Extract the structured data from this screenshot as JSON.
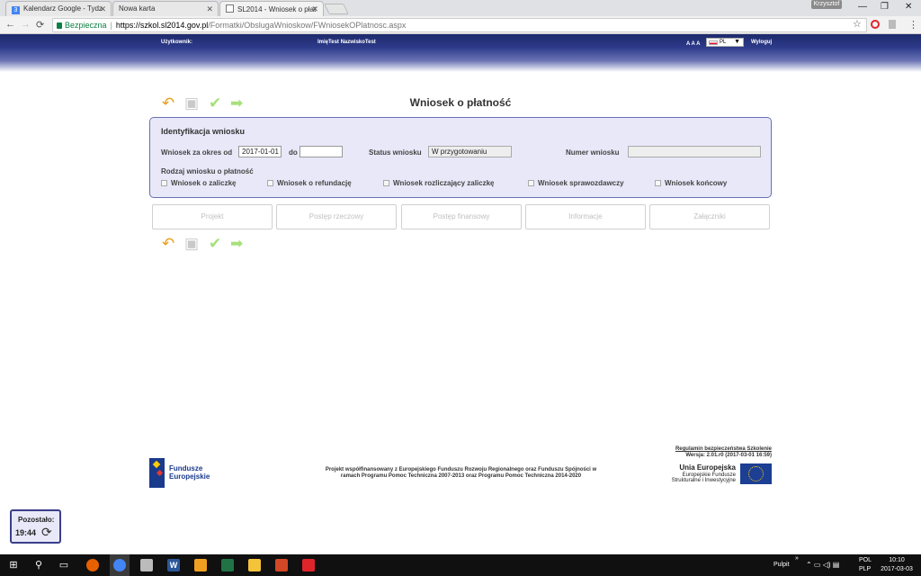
{
  "browser": {
    "tabs": [
      {
        "label": "Kalendarz Google - Tydz",
        "favicon_color": "#4285f4",
        "favicon_text": "3"
      },
      {
        "label": "Nowa karta"
      },
      {
        "label": "SL2014 - Wniosek o płat",
        "active": true
      }
    ],
    "close_glyph": "✕",
    "user_badge": "Krzysztof",
    "window_controls": {
      "minimize": "—",
      "restore": "❐",
      "close": "✕"
    },
    "nav": {
      "back": "←",
      "forward": "→",
      "reload": "⟳"
    },
    "address": {
      "security_label": "Bezpieczna",
      "separator": "|",
      "url_host": "https://szkol.sl2014.gov.pl",
      "url_path": "/Formatki/ObslugaWnioskow/FWniosekOPlatnosc.aspx"
    },
    "toolbar_icons": {
      "star": "☆",
      "menu": "⋮"
    }
  },
  "app_header": {
    "user_label": "Użytkownik:",
    "user_name": "ImięTest NazwiskoTest",
    "font_size_controls": "A A A",
    "language": "PL",
    "dropdown_arrow": "▼",
    "logout": "Wyloguj"
  },
  "toolbar_glyphs": {
    "undo": "↶",
    "save": "▣",
    "check": "✔",
    "forward": "➡"
  },
  "page_title": "Wniosek o płatność",
  "identification": {
    "heading": "Identyfikacja wniosku",
    "period_label": "Wniosek za okres od",
    "period_from": "2017-01-01",
    "to_label": "do",
    "period_to": "",
    "status_label": "Status wniosku",
    "status_value": "W przygotowaniu",
    "number_label": "Numer wniosku",
    "number_value": "",
    "type_heading": "Rodzaj wniosku o płatność",
    "types": [
      "Wniosek o zaliczkę",
      "Wniosek o refundację",
      "Wniosek rozliczający zaliczkę",
      "Wniosek sprawozdawczy",
      "Wniosek końcowy"
    ]
  },
  "sections": [
    "Projekt",
    "Postęp rzeczowy",
    "Postęp finansowy",
    "Informacje",
    "Załączniki"
  ],
  "footer": {
    "fe_logo_line1": "Fundusze",
    "fe_logo_line2": "Europejskie",
    "cofinancing_line1": "Projekt współfinansowany z Europejskiego Funduszu Rozwoju Regionalnego oraz Funduszu Spójności w",
    "cofinancing_line2": "ramach Programu Pomoc Techniczna 2007-2013 oraz Programu Pomoc Techniczna 2014-2020",
    "security_rules": "Regulamin bezpieczeństwa Szkolenie",
    "version": "Wersja: 2.01.r0 (2017-03-01 16:59)",
    "eu_title": "Unia Europejska",
    "eu_sub1": "Europejskie Fundusze",
    "eu_sub2": "Strukturalne i Inwestycyjne"
  },
  "timer": {
    "label": "Pozostało:",
    "value": "19:44",
    "refresh_glyph": "⟳"
  },
  "taskbar": {
    "start_glyph": "⊞",
    "search_glyph": "⚲",
    "taskview_glyph": "▭",
    "desktop_label": "Pulpit",
    "overflow_glyph": "»",
    "tray_glyphs": "⌃ ▭ ◁) ▤",
    "lang1": "POL",
    "lang2": "PLP",
    "time": "10:10",
    "date": "2017-03-03",
    "apps": [
      {
        "name": "firefox",
        "color": "#e66000"
      },
      {
        "name": "chrome",
        "color": "#4285f4",
        "active": true
      },
      {
        "name": "notepad",
        "color": "#bbbbbb"
      },
      {
        "name": "word",
        "color": "#2b579a",
        "glyph": "W"
      },
      {
        "name": "app-orange",
        "color": "#f0a020"
      },
      {
        "name": "excel",
        "color": "#217346"
      },
      {
        "name": "explorer",
        "color": "#f3c33a"
      },
      {
        "name": "powerpoint",
        "color": "#d24726"
      },
      {
        "name": "acrobat",
        "color": "#e0242c"
      }
    ]
  }
}
